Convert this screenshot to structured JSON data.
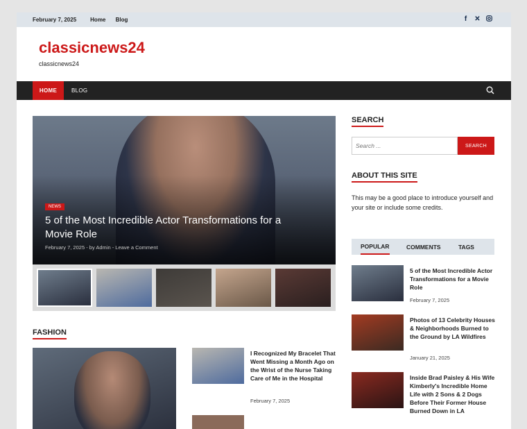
{
  "topbar": {
    "date": "February 7, 2025",
    "menu": [
      "Home",
      "Blog"
    ],
    "social_icons": [
      "facebook-icon",
      "x-icon",
      "instagram-icon"
    ]
  },
  "site": {
    "title": "classicnews24",
    "description": "classicnews24"
  },
  "nav": {
    "items": [
      "HOME",
      "BLOG"
    ],
    "active": "HOME"
  },
  "hero": {
    "category": "NEWS",
    "title": "5 of the Most Incredible Actor Transformations for a Movie Role",
    "meta": "February 7, 2025  -  by Admin  -  Leave a Comment"
  },
  "sidebar": {
    "search_title": "SEARCH",
    "search_placeholder": "Search ...",
    "search_button": "SEARCH",
    "about_title": "ABOUT THIS SITE",
    "about_text": "This may be a good place to introduce yourself and your site or include some credits.",
    "tabs": [
      "POPULAR",
      "COMMENTS",
      "TAGS"
    ],
    "posts": [
      {
        "title": "5 of the Most Incredible Actor Transformations for a Movie Role",
        "date": "February 7, 2025"
      },
      {
        "title": "Photos of 13 Celebrity Houses & Neighborhoods Burned to the Ground by LA Wildfires",
        "date": "January 21, 2025"
      },
      {
        "title": "Inside Brad Paisley & His Wife Kimberly's Incredible Home Life with 2 Sons & 2 Dogs Before Their Former House Burned Down in LA",
        "date": ""
      }
    ]
  },
  "fashion": {
    "title": "FASHION",
    "item": {
      "title": "I Recognized My Bracelet That Went Missing a Month Ago on the Wrist of the Nurse Taking Care of Me in the Hospital",
      "date": "February 7, 2025"
    }
  },
  "colors": {
    "accent": "#cc1818",
    "nav_bg": "#222222",
    "topbar_bg": "#dee4ea"
  }
}
